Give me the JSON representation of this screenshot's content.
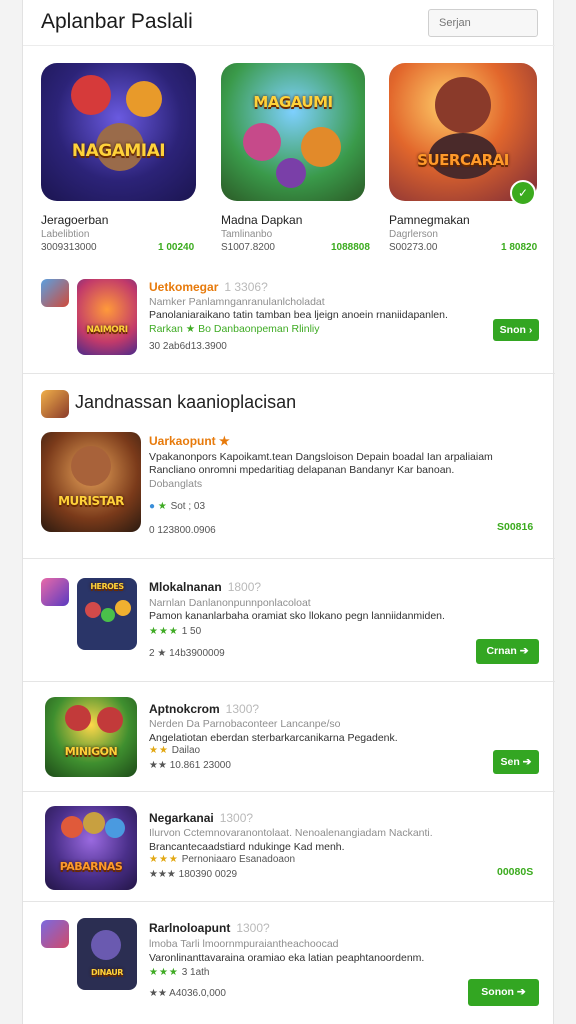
{
  "header": {
    "title": "Aplanbar Paslali",
    "search_placeholder": "Serjan"
  },
  "featured": [
    {
      "art": "NAGAMIAI",
      "name": "Jeragoerban",
      "subtitle": "Labelibtion",
      "meta": "3009313000",
      "price": "1 00240",
      "colors": [
        "#3a2a9c",
        "#d63a3a",
        "#f3b63a"
      ]
    },
    {
      "art": "MAGAUMI",
      "name": "Madna Dapkan",
      "subtitle": "Tamlinanbo",
      "meta": "S1007.8200",
      "price": "1088808",
      "colors": [
        "#3f8a3a",
        "#9b5ad6",
        "#f0a830"
      ]
    },
    {
      "art": "SUERCARAI",
      "name": "Pamnegmakan",
      "subtitle": "Dagrlerson",
      "meta": "S00273.00",
      "price": "1 80820",
      "colors": [
        "#d4522c",
        "#7a3b2a",
        "#f4c25a"
      ]
    }
  ],
  "list_top": {
    "name": "Uetkomegar",
    "num": "1 3306?",
    "line1": "Namker Panlamnganranulanlcholadat",
    "line2": "Panolaniaraikano tatin tamban bea ljeign anoein rnaniidapanlen.",
    "line3": "Rarkan ★ Bo Danbaonpeman Rlinliy",
    "rating": "30 2ab6d13.3900",
    "button": "Snon",
    "art": "NAIMORI"
  },
  "section": {
    "title": "Jandnassan kaanioplacisan"
  },
  "section_feature": {
    "name": "Uarkaopunt ★",
    "line1": "Vpakanonpors Kapoikamt.tean  Dangsloison Depain  boadal Ian arpaliaiam",
    "line2": "Rancliano onromni mpedaritiag delapanan Bandanyr Kar banoan.",
    "line3": "Dobanglats",
    "rating_inline": "Sot ; 03",
    "rating": "0 123800.0906",
    "price": "S00816",
    "art": "MURISTAR"
  },
  "list": [
    {
      "name": "Mlokalnanan",
      "num": "1800?",
      "line1": "Narnlan Danlanonpunnponlacoloat",
      "line2": "Pamon  kananlarbaha oramiat sko llokano pegn lanniidanmiden.",
      "stars": "★★★",
      "stars_text": "1 50",
      "rating": "2 ★ 14b3900009",
      "button": "Crnan",
      "art": "HEROES",
      "art_bg": "#2a3568"
    },
    {
      "name": "Aptnokcrom",
      "num": "1300?",
      "line1": "Nerden Da Parnobaconteer Lancanpe/so",
      "line2": "Angelatiotan eberdan sterbarkarcanikarna Pegadenk.",
      "stars": "★★",
      "stars_text": "Dailao",
      "rating": "★★ 10.861 23000",
      "button": "Sen",
      "art": "MINIGON",
      "art_bg": "#3f8f2f"
    },
    {
      "name": "Negarkanai",
      "num": "1300?",
      "line1": "Ilurvon  Cctemnovaranontolaat. Nenoalenangiadam Nackanti.",
      "line2": "Brancantecaadstiard ndukinge Kad menh.",
      "stars": "★★★",
      "stars_text": "Pernoniaaro Esanadoaon",
      "rating": "★★★ 180390 0029",
      "price": "00080S",
      "art": "PABARNAS",
      "art_bg": "#5a3fa0"
    },
    {
      "name": "Rarlnoloapunt",
      "num": "1300?",
      "line1": "lmoba Tarli  lmoornmpuraiantheachoocad",
      "line2": "Varonlinanttavaraina oramiao eka latian peaphtanoordenm.",
      "stars": "★★★",
      "stars_text": "3 1ath",
      "rating": "★★ A4036.0,000",
      "button": "Sonon",
      "art": "DINAUR",
      "art_bg": "#2b2e52"
    }
  ]
}
